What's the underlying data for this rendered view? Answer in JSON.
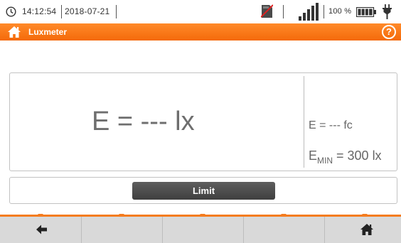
{
  "status_bar": {
    "time": "14:12:54",
    "date": "2018-07-21",
    "battery_percent": "100 %",
    "icons": [
      "clock-icon",
      "sd-card-icon",
      "signal-strength-icon",
      "battery-icon",
      "plug-icon"
    ]
  },
  "title_bar": {
    "title": "Luxmeter",
    "help_label": "?",
    "icons": [
      "home-icon",
      "help-icon"
    ],
    "accent_color": "#f47c20"
  },
  "measurement": {
    "main_value": "E = --- lx",
    "fc_value": "E = --- fc",
    "emin_prefix": "E",
    "emin_sub": "MIN",
    "emin_value": " = 300 lx"
  },
  "limit": {
    "button_label": "Limit"
  },
  "bottom_bar": {
    "buttons": [
      "back-icon",
      "",
      "",
      "",
      "home-icon"
    ]
  }
}
